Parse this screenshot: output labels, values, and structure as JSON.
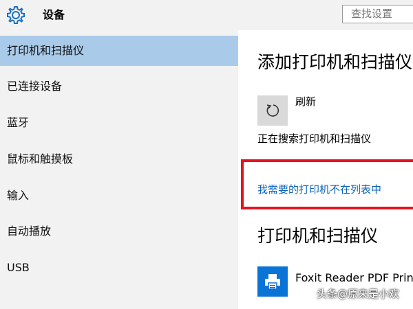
{
  "app": {
    "title": "设备",
    "icon": "gear-icon",
    "accent": "#0a73d6"
  },
  "search": {
    "placeholder": "查找设置"
  },
  "sidebar": {
    "selected_color": "#a9cbe9",
    "items": [
      {
        "label": "打印机和扫描仪",
        "selected": true
      },
      {
        "label": "已连接设备",
        "selected": false
      },
      {
        "label": "蓝牙",
        "selected": false
      },
      {
        "label": "鼠标和触摸板",
        "selected": false
      },
      {
        "label": "输入",
        "selected": false
      },
      {
        "label": "自动播放",
        "selected": false
      },
      {
        "label": "USB",
        "selected": false
      }
    ]
  },
  "main": {
    "add_section_title": "添加打印机和扫描仪",
    "refresh_label": "刷新",
    "refresh_icon": "refresh-icon",
    "status_text": "正在搜索打印机和扫描仪",
    "missing_printer_link": "我需要的打印机不在列表中",
    "highlight_color": "#e8121c",
    "printers_section_title": "打印机和扫描仪",
    "printers": [
      {
        "name": "Foxit Reader PDF Printer",
        "icon": "printer-icon"
      }
    ]
  },
  "watermark": {
    "text": "头条@原来是小欢"
  }
}
